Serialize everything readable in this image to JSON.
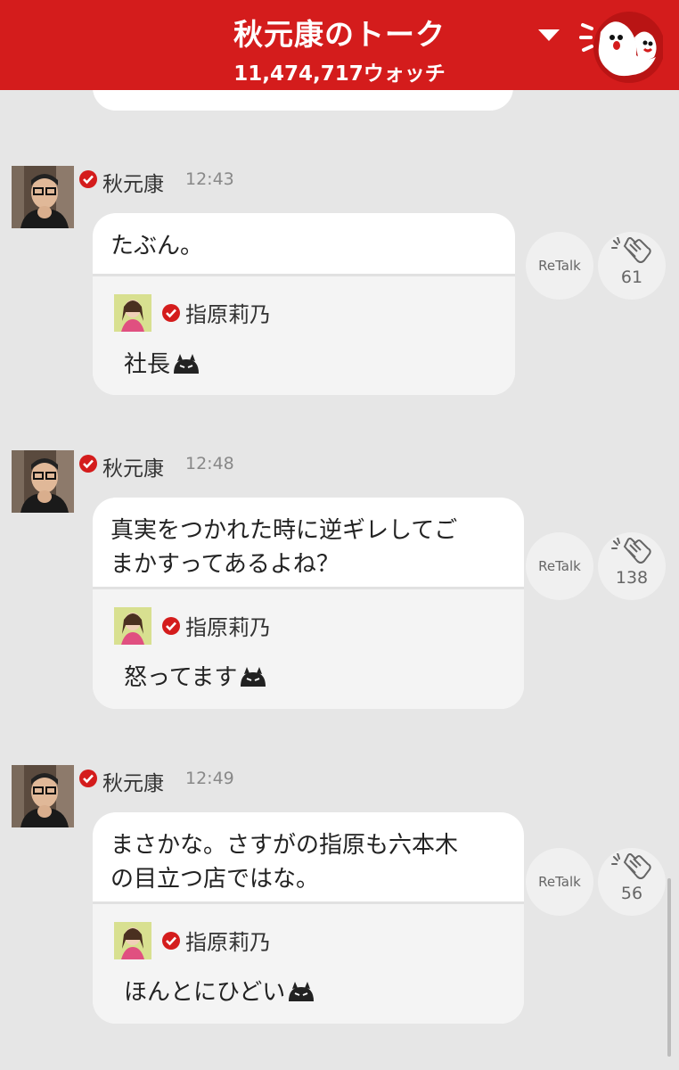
{
  "header": {
    "title": "秋元康のトーク",
    "watch_count": "11,474,717ウォッチ",
    "dropdown_icon": "chevron-down-icon",
    "mascot_icon": "ghost-mascot-icon",
    "brand_color": "#d41c1c"
  },
  "messages": [
    {
      "author": "秋元康",
      "time": "12:43",
      "text_lines": [
        "たぶん。"
      ],
      "quote": {
        "author": "指原莉乃",
        "text": "社長"
      },
      "retalk_label": "ReTalk",
      "clap_count": "61"
    },
    {
      "author": "秋元康",
      "time": "12:48",
      "text_lines": [
        "真実をつかれた時に逆ギレしてご",
        "まかすってあるよね？"
      ],
      "quote": {
        "author": "指原莉乃",
        "text": "怒ってます"
      },
      "retalk_label": "ReTalk",
      "clap_count": "138"
    },
    {
      "author": "秋元康",
      "time": "12:49",
      "text_lines": [
        "まさかな。さすがの指原も六本木",
        "の目立つ店ではな。"
      ],
      "quote": {
        "author": "指原莉乃",
        "text": "ほんとにひどい"
      },
      "retalk_label": "ReTalk",
      "clap_count": "56"
    }
  ]
}
